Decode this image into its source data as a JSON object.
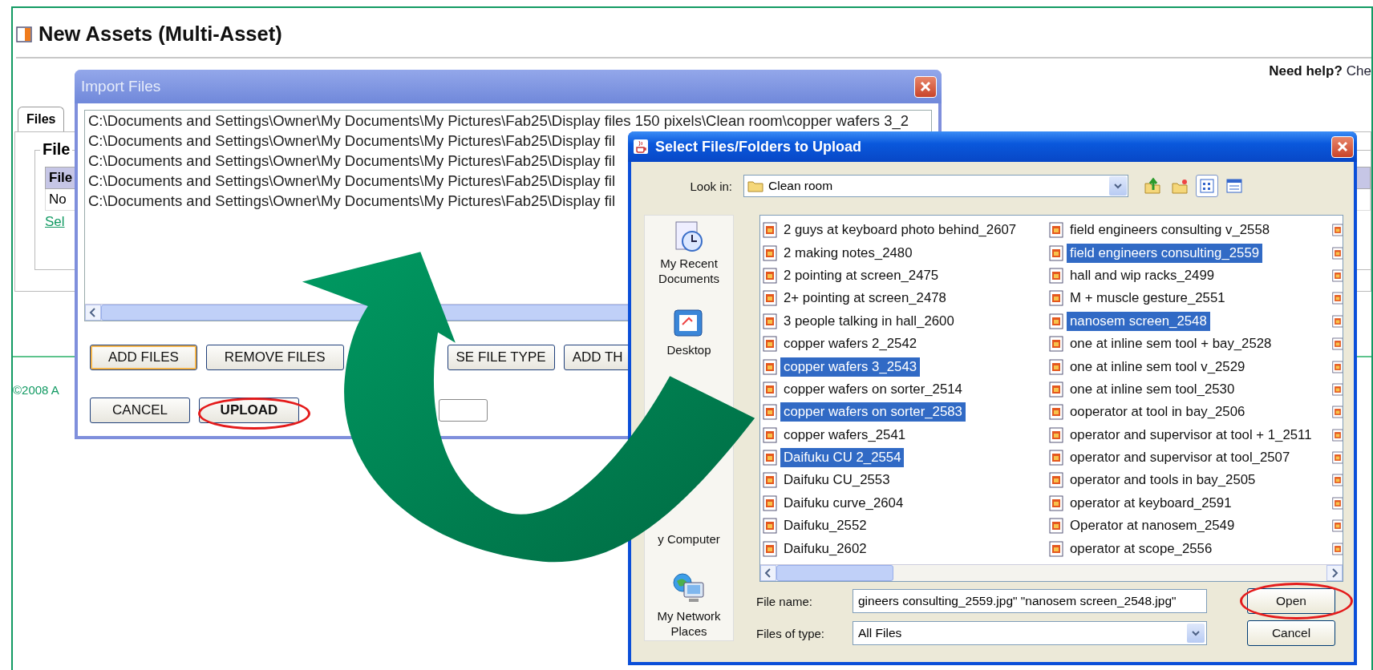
{
  "page": {
    "title": "New Assets (Multi-Asset)",
    "help": {
      "label": "Need help?",
      "link": "Che"
    },
    "tabs": [
      {
        "label": "Files",
        "selected": true
      }
    ],
    "legend": "File",
    "table": {
      "header": "File",
      "cell": "No"
    },
    "link": "Sel",
    "footer": "©2008 A"
  },
  "import_dialog": {
    "title": "Import Files",
    "paths": [
      "C:\\Documents and Settings\\Owner\\My Documents\\My Pictures\\Fab25\\Display files 150 pixels\\Clean room\\copper wafers 3_2",
      "C:\\Documents and Settings\\Owner\\My Documents\\My Pictures\\Fab25\\Display fil",
      "C:\\Documents and Settings\\Owner\\My Documents\\My Pictures\\Fab25\\Display fil",
      "C:\\Documents and Settings\\Owner\\My Documents\\My Pictures\\Fab25\\Display fil",
      "C:\\Documents and Settings\\Owner\\My Documents\\My Pictures\\Fab25\\Display fil"
    ],
    "buttons": [
      {
        "label": "ADD FILES",
        "focused": true
      },
      {
        "label": "REMOVE FILES",
        "focused": false
      },
      {
        "label": "SE FILE TYPE",
        "focused": false
      },
      {
        "label": "ADD TH",
        "focused": false
      }
    ],
    "actions": [
      {
        "label": "CANCEL",
        "default": false
      },
      {
        "label": "UPLOAD",
        "default": true
      }
    ]
  },
  "file_dialog": {
    "title": "Select Files/Folders to Upload",
    "look_in_label": "Look in:",
    "look_in": "Clean room",
    "places": [
      "My Recent Documents",
      "Desktop",
      "y Computer",
      "My Network Places"
    ],
    "files": [
      {
        "name": "2 guys at keyboard photo behind_2607",
        "selected": false
      },
      {
        "name": "2 making notes_2480",
        "selected": false
      },
      {
        "name": "2 pointing at screen_2475",
        "selected": false
      },
      {
        "name": "2+ pointing at screen_2478",
        "selected": false
      },
      {
        "name": "3 people talking in hall_2600",
        "selected": false
      },
      {
        "name": "copper wafers 2_2542",
        "selected": false
      },
      {
        "name": "copper wafers 3_2543",
        "selected": true
      },
      {
        "name": "copper wafers on sorter_2514",
        "selected": false
      },
      {
        "name": "copper wafers on sorter_2583",
        "selected": true
      },
      {
        "name": "copper wafers_2541",
        "selected": false
      },
      {
        "name": "Daifuku CU 2_2554",
        "selected": true
      },
      {
        "name": "Daifuku CU_2553",
        "selected": false
      },
      {
        "name": "Daifuku curve_2604",
        "selected": false
      },
      {
        "name": "Daifuku_2552",
        "selected": false
      },
      {
        "name": "Daifuku_2602",
        "selected": false
      },
      {
        "name": "field engineers consulting v_2558",
        "selected": false
      },
      {
        "name": "field engineers consulting_2559",
        "selected": true
      },
      {
        "name": "hall and wip racks_2499",
        "selected": false
      },
      {
        "name": "M + muscle gesture_2551",
        "selected": false
      },
      {
        "name": "nanosem screen_2548",
        "selected": true
      },
      {
        "name": "one at inline sem tool + bay_2528",
        "selected": false
      },
      {
        "name": "one at inline sem tool v_2529",
        "selected": false
      },
      {
        "name": "one at inline sem tool_2530",
        "selected": false
      },
      {
        "name": "ooperator at tool in bay_2506",
        "selected": false
      },
      {
        "name": "operator and supervisor at tool + 1_2511",
        "selected": false
      },
      {
        "name": "operator and supervisor at tool_2507",
        "selected": false
      },
      {
        "name": "operator and tools in bay_2505",
        "selected": false
      },
      {
        "name": "operator at keyboard_2591",
        "selected": false
      },
      {
        "name": "Operator at nanosem_2549",
        "selected": false
      },
      {
        "name": "operator at scope_2556",
        "selected": false
      }
    ],
    "file_name_label": "File name:",
    "file_name": "gineers consulting_2559.jpg\" \"nanosem screen_2548.jpg\"",
    "type_label": "Files of type:",
    "type": "All Files",
    "buttons": [
      "Open",
      "Cancel"
    ]
  }
}
